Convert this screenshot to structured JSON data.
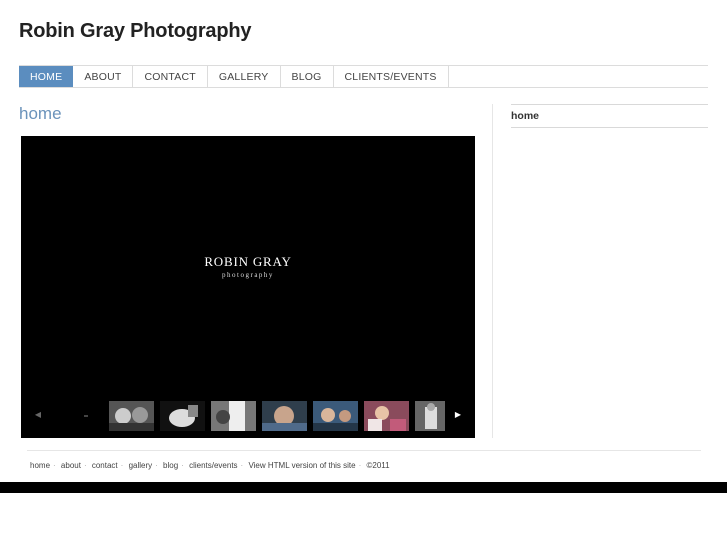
{
  "site": {
    "title": "Robin Gray Photography"
  },
  "nav": {
    "items": [
      {
        "label": "HOME",
        "active": true
      },
      {
        "label": "ABOUT"
      },
      {
        "label": "CONTACT"
      },
      {
        "label": "GALLERY"
      },
      {
        "label": "BLOG"
      },
      {
        "label": "CLIENTS/EVENTS"
      }
    ]
  },
  "main": {
    "heading": "home"
  },
  "sidebar": {
    "items": [
      {
        "label": "home"
      }
    ]
  },
  "slideshow": {
    "brand_name": "ROBIN GRAY",
    "brand_sub": "photography",
    "prev_icon": "triangle-left-icon",
    "next_icon": "triangle-right-icon",
    "thumb_count": 7
  },
  "footer": {
    "links": [
      "home",
      "about",
      "contact",
      "gallery",
      "blog",
      "clients/events",
      "View HTML version of this site"
    ],
    "copyright": "©2011"
  },
  "colors": {
    "accent": "#5b8dbf",
    "heading": "#6b93bb"
  }
}
